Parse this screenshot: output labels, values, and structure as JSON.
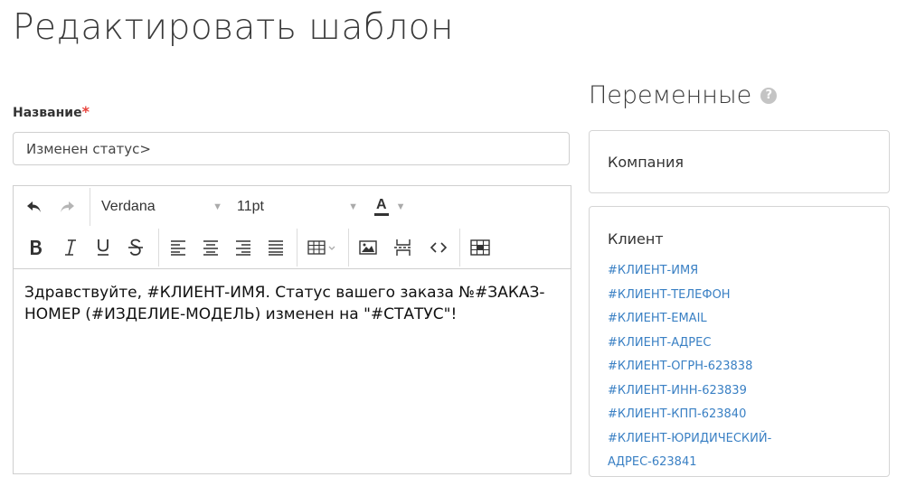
{
  "page": {
    "title": "Редактировать шаблон"
  },
  "form": {
    "name_label": "Название",
    "required_mark": "*",
    "name_value": "Изменен статус>"
  },
  "editor": {
    "font_family": "Verdana",
    "font_size": "11pt",
    "text_color_label": "A",
    "content": "Здравствуйте, #КЛИЕНТ-ИМЯ. Статус вашего заказа №#ЗАКАЗ-НОМЕР (#ИЗДЕЛИЕ-МОДЕЛЬ) изменен на \"#СТАТУС\"!"
  },
  "variables": {
    "title": "Переменные",
    "help": "?",
    "company": {
      "title": "Компания"
    },
    "client": {
      "title": "Клиент",
      "items": [
        "#КЛИЕНТ-ИМЯ",
        "#КЛИЕНТ-ТЕЛЕФОН",
        "#КЛИЕНТ-EMAIL",
        "#КЛИЕНТ-АДРЕС",
        "#КЛИЕНТ-ОГРН-623838",
        "#КЛИЕНТ-ИНН-623839",
        "#КЛИЕНТ-КПП-623840",
        "#КЛИЕНТ-ЮРИДИЧЕСКИЙ-",
        "АДРЕС-623841"
      ]
    }
  },
  "colors": {
    "link": "#3a80c4",
    "required": "#e8423b",
    "text_color_underline": "#333333"
  },
  "icons": {
    "toolbar_row1": [
      "undo-icon",
      "redo-icon"
    ],
    "toolbar_row2": [
      "bold-icon",
      "italic-icon",
      "underline-icon",
      "strikethrough-icon",
      "align-left-icon",
      "align-center-icon",
      "align-right-icon",
      "align-justify-icon",
      "table-icon",
      "image-icon",
      "page-break-icon",
      "source-code-icon",
      "template-icon"
    ]
  }
}
